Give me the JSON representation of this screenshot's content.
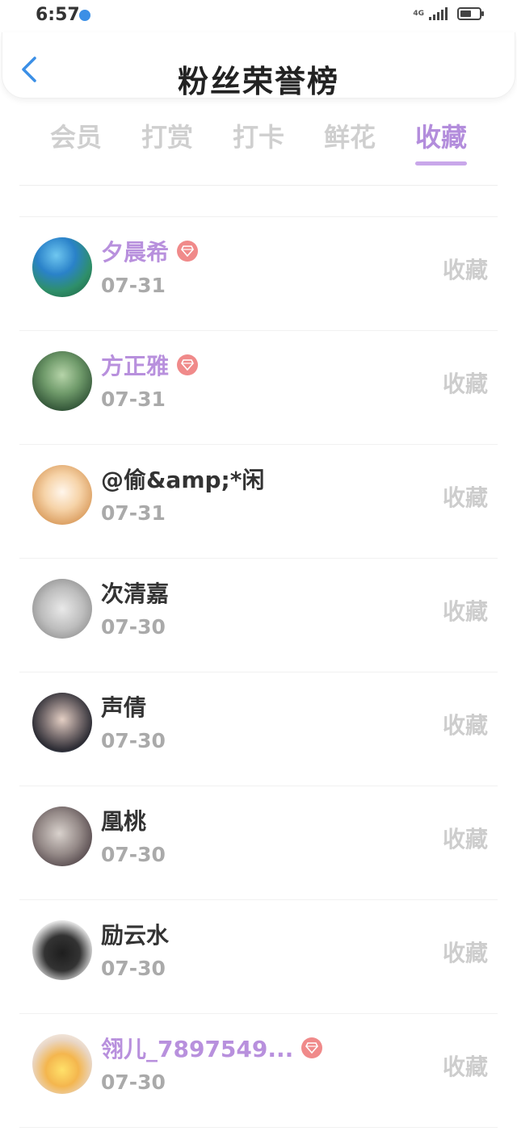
{
  "status": {
    "time": "6:57",
    "network": "4G"
  },
  "header": {
    "title": "粉丝荣誉榜"
  },
  "tabs": [
    {
      "label": "会员",
      "active": false
    },
    {
      "label": "打赏",
      "active": false
    },
    {
      "label": "打卡",
      "active": false
    },
    {
      "label": "鲜花",
      "active": false
    },
    {
      "label": "收藏",
      "active": true
    }
  ],
  "colors": {
    "accent": "#b38ddc",
    "vip_name": "#b890dd",
    "badge": "#f08a8a",
    "inactive_tab": "#cfcfcf",
    "back_icon": "#3b8fe6"
  },
  "fans": [
    {
      "name": "夕晨希",
      "vip": true,
      "date": "07-31",
      "action": "收藏"
    },
    {
      "name": "方正雅",
      "vip": true,
      "date": "07-31",
      "action": "收藏"
    },
    {
      "name": "@偷&amp;*闲",
      "vip": false,
      "date": "07-31",
      "action": "收藏"
    },
    {
      "name": "次清嘉",
      "vip": false,
      "date": "07-30",
      "action": "收藏"
    },
    {
      "name": "声倩",
      "vip": false,
      "date": "07-30",
      "action": "收藏"
    },
    {
      "name": "凰桃",
      "vip": false,
      "date": "07-30",
      "action": "收藏"
    },
    {
      "name": "励云水",
      "vip": false,
      "date": "07-30",
      "action": "收藏"
    },
    {
      "name": "翎儿_7897549...",
      "vip": true,
      "date": "07-30",
      "action": "收藏"
    }
  ]
}
